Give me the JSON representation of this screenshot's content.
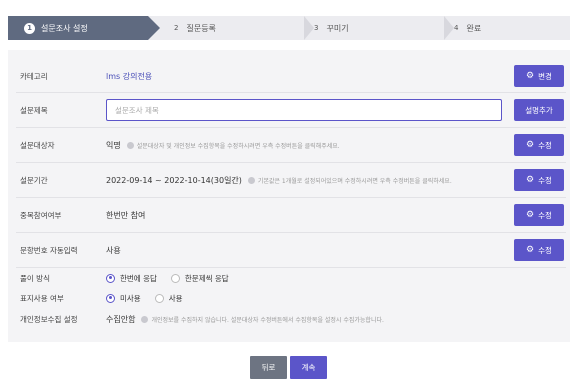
{
  "steps": [
    {
      "num": "1",
      "label": "설문조사 설정"
    },
    {
      "num": "2",
      "label": "질문등록"
    },
    {
      "num": "3",
      "label": "꾸미기"
    },
    {
      "num": "4",
      "label": "완료"
    }
  ],
  "rows": {
    "category": {
      "label": "카테고리",
      "value": "lms 강의전용",
      "button": "변경"
    },
    "title": {
      "label": "설문제목",
      "placeholder": "설문조사 제목",
      "button": "설명추가"
    },
    "target": {
      "label": "설문대상자",
      "value": "익명",
      "hint": "설문대상자 및 개인정보 수집항목을 수정하시려면 우측 수정버튼을 클릭해주세요.",
      "button": "수정"
    },
    "period": {
      "label": "설문기간",
      "value": "2022-09-14 ~ 2022-10-14(30일간)",
      "hint": "기본값은 1개월로 설정되어있으며 수정하시려면 우측 수정버튼을 클릭하세요.",
      "button": "수정"
    },
    "duplicate": {
      "label": "중복참여여부",
      "value": "한번만 참여",
      "button": "수정"
    },
    "autonum": {
      "label": "문항번호 자동입력",
      "value": "사용",
      "button": "수정"
    },
    "method": {
      "label": "풀이 방식",
      "options": [
        "한번에 응답",
        "한문제씩 응답"
      ],
      "selected": 0
    },
    "display": {
      "label": "표지사용 여부",
      "options": [
        "미사용",
        "사용"
      ],
      "selected": 0
    },
    "privacy": {
      "label": "개인정보수집 설정",
      "value": "수집안함",
      "hint": "개인정보를 수집하지 않습니다. 설문대상자 수정버튼에서 수집항목을 설정시 수집가능합니다."
    }
  },
  "footer": {
    "back": "뒤로",
    "next": "계속"
  },
  "colors": {
    "accent": "#5b55c9",
    "step_active": "#5f6a80",
    "panel": "#f4f4f6"
  }
}
